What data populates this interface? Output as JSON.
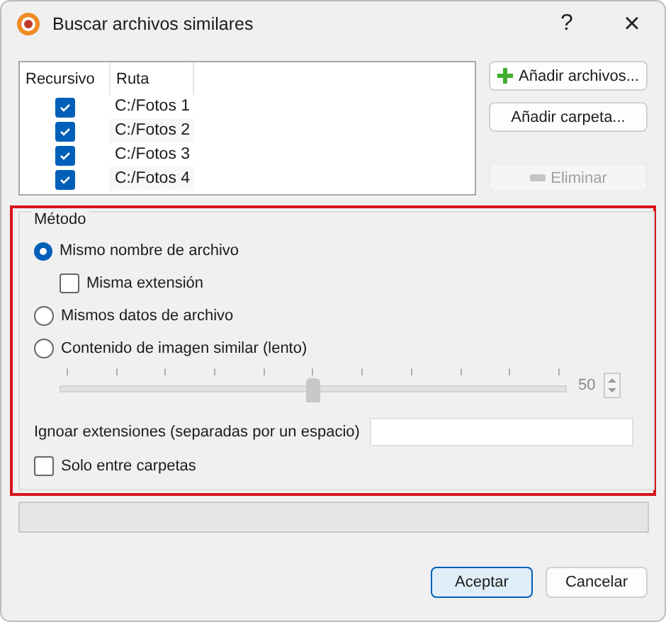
{
  "window": {
    "title": "Buscar archivos similares",
    "help": "?",
    "close": "×"
  },
  "table": {
    "columns": [
      "Recursivo",
      "Ruta"
    ],
    "rows": [
      {
        "checked": true,
        "path": "C:/Fotos 1"
      },
      {
        "checked": true,
        "path": "C:/Fotos 2"
      },
      {
        "checked": true,
        "path": "C:/Fotos 3"
      },
      {
        "checked": true,
        "path": "C:/Fotos 4"
      }
    ]
  },
  "side_buttons": [
    {
      "label": "Añadir archivos...",
      "disabled": false
    },
    {
      "label": "Añadir carpeta...",
      "disabled": false
    },
    {
      "label": "Eliminar",
      "disabled": true
    }
  ],
  "method": {
    "title": "Método",
    "options": [
      {
        "kind": "radio",
        "label": "Mismo nombre de archivo",
        "selected": true
      },
      {
        "kind": "checkbox",
        "label": "Misma extensión",
        "checked": false
      },
      {
        "kind": "radio",
        "label": "Mismos datos de archivo",
        "selected": false
      },
      {
        "kind": "radio",
        "label": "Contenido de imagen similar (lento)",
        "selected": false
      }
    ],
    "slider": {
      "level": 0.5,
      "reading": "50",
      "disabled": true
    },
    "ignore_label": "Ignoar extensiones (separadas por un espacio)",
    "folders_only": {
      "label": "Solo entre carpetas",
      "checked": false
    }
  },
  "buttons": [
    {
      "label": "Aceptar",
      "default": true
    },
    {
      "label": "Cancelar",
      "default": false
    }
  ]
}
